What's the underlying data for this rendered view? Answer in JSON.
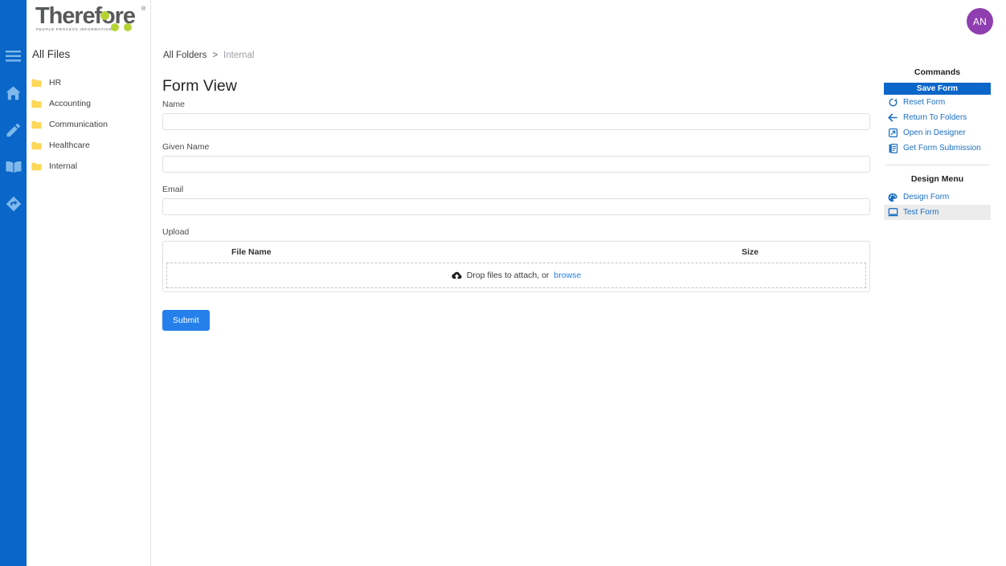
{
  "rail": {
    "icons": [
      {
        "name": "hamburger-menu-icon",
        "label": "Menu"
      },
      {
        "name": "home-icon",
        "label": "Home"
      },
      {
        "name": "pencil-icon",
        "label": "Edit"
      },
      {
        "name": "book-icon",
        "label": "Library"
      },
      {
        "name": "workflow-diamond-icon",
        "label": "Workflow"
      }
    ],
    "color": "#0a66c8"
  },
  "logo": {
    "word": "Therefore",
    "trademark": "®",
    "tagline": "PEOPLE  PROCESS  INFORMATION",
    "accent_color": "#b5d334",
    "text_color": "#58595b"
  },
  "sidebar": {
    "heading": "All Files",
    "folders": [
      {
        "label": "HR"
      },
      {
        "label": "Accounting"
      },
      {
        "label": "Communication"
      },
      {
        "label": "Healthcare"
      },
      {
        "label": "Internal"
      }
    ],
    "folder_color": "#fdd757"
  },
  "header": {
    "avatar_initials": "AN",
    "avatar_color": "#8f3eb0"
  },
  "breadcrumb": {
    "root": "All Folders",
    "separator": ">",
    "current": "Internal"
  },
  "main": {
    "title": "Form View",
    "fields": [
      {
        "label": "Name",
        "value": "",
        "placeholder": ""
      },
      {
        "label": "Given Name",
        "value": "",
        "placeholder": ""
      },
      {
        "label": "Email",
        "value": "",
        "placeholder": ""
      }
    ],
    "upload": {
      "label": "Upload",
      "col_file_name": "File Name",
      "col_size": "Size",
      "drop_text": "Drop files to attach, or",
      "browse_link": "browse",
      "icon": "cloud-upload-icon"
    },
    "submit_label": "Submit",
    "submit_color": "#2680eb"
  },
  "commands": {
    "title": "Commands",
    "primary": {
      "label": "Save Form",
      "color": "#0a66c8"
    },
    "items": [
      {
        "label": "Reset Form",
        "icon": "refresh-icon"
      },
      {
        "label": "Return To Folders",
        "icon": "arrow-left-icon"
      },
      {
        "label": "Open in Designer",
        "icon": "external-link-icon"
      },
      {
        "label": "Get Form Submission",
        "icon": "document-list-icon"
      }
    ]
  },
  "design_menu": {
    "title": "Design Menu",
    "items": [
      {
        "label": "Design Form",
        "icon": "palette-icon",
        "selected": false
      },
      {
        "label": "Test Form",
        "icon": "monitor-icon",
        "selected": true
      }
    ]
  }
}
